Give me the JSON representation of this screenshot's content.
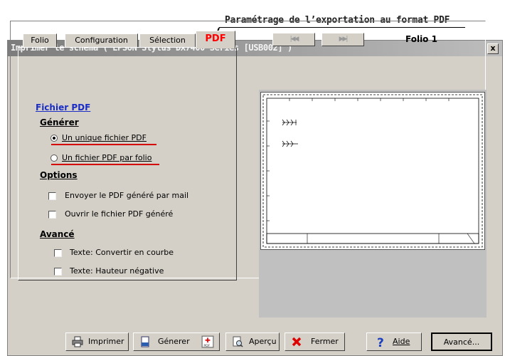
{
  "annotation": {
    "callout": "Paramétrage de l’exportation au format PDF"
  },
  "dialog": {
    "title": "Imprimer le schéma ( EPSON Stylus DX7400 Series [USB002] )",
    "close": "x"
  },
  "tabs": [
    "Folio",
    "Configuration",
    "Sélection",
    "PDF"
  ],
  "active_tab": "PDF",
  "panel": {
    "file_link": "Fichier PDF",
    "generate_heading": "Générer",
    "radio_single": "Un unique fichier PDF",
    "radio_per_folio": "Un fichier PDF par folio",
    "options_heading": "Options",
    "check_mail": "Envoyer le PDF généré par mail",
    "check_open": "Ouvrir le fichier PDF généré",
    "advanced_heading": "Avancé",
    "check_curve": "Texte: Convertir en courbe",
    "check_negative": "Texte: Hauteur négative"
  },
  "preview": {
    "folio_label": "Folio 1",
    "prev": "|◀◀",
    "next": "▶▶|"
  },
  "buttons": {
    "print": "Imprimer",
    "generate": "Génerer",
    "preview": "Aperçu",
    "close": "Fermer",
    "help": "Aide",
    "advanced": "Avancé..."
  },
  "colors": {
    "accent_red": "#ff0000",
    "link_blue": "#1a2ec6",
    "underline_red": "#d40000"
  }
}
